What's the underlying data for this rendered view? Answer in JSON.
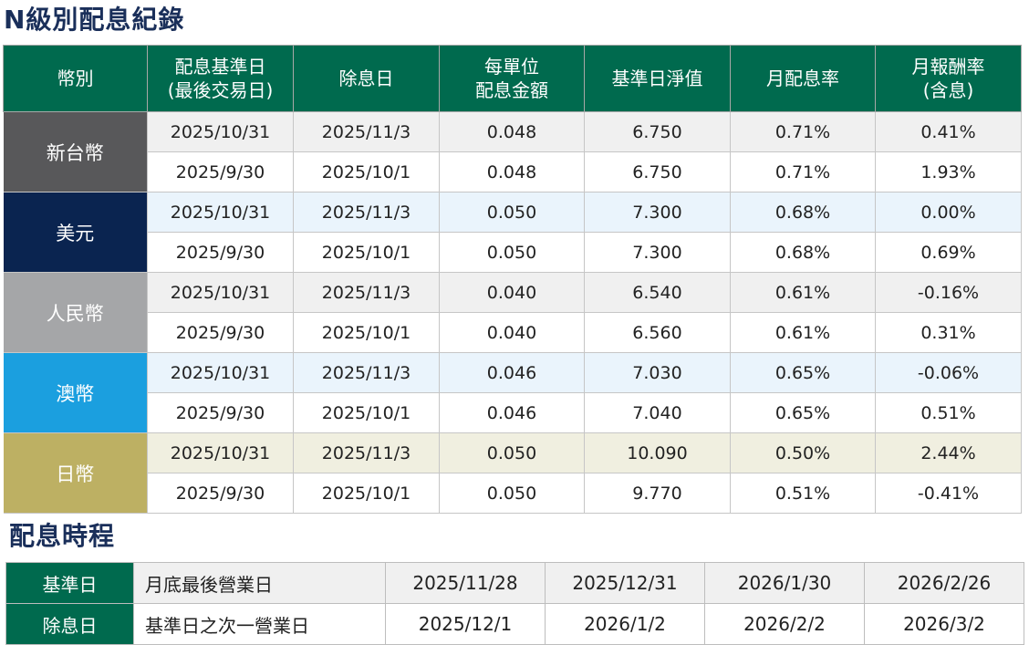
{
  "title": "N級別配息紀錄",
  "headers": [
    {
      "line1": "幣別",
      "line2": ""
    },
    {
      "line1": "配息基準日",
      "line2": "(最後交易日)"
    },
    {
      "line1": "除息日",
      "line2": ""
    },
    {
      "line1": "每單位",
      "line2": "配息金額"
    },
    {
      "line1": "基準日淨值",
      "line2": ""
    },
    {
      "line1": "月配息率",
      "line2": ""
    },
    {
      "line1": "月報酬率",
      "line2": "(含息)"
    }
  ],
  "currencies": [
    {
      "name": "新台幣",
      "color": "#58585a",
      "row_bg": "#f0f0f0",
      "rows": [
        {
          "record_date": "2025/10/31",
          "ex_date": "2025/11/3",
          "amount": "0.048",
          "nav": "6.750",
          "yield": "0.71%",
          "return": "0.41%"
        },
        {
          "record_date": "2025/9/30",
          "ex_date": "2025/10/1",
          "amount": "0.048",
          "nav": "6.750",
          "yield": "0.71%",
          "return": "1.93%"
        }
      ]
    },
    {
      "name": "美元",
      "color": "#0a2450",
      "row_bg": "#eaf4fc",
      "rows": [
        {
          "record_date": "2025/10/31",
          "ex_date": "2025/11/3",
          "amount": "0.050",
          "nav": "7.300",
          "yield": "0.68%",
          "return": "0.00%"
        },
        {
          "record_date": "2025/9/30",
          "ex_date": "2025/10/1",
          "amount": "0.050",
          "nav": "7.300",
          "yield": "0.68%",
          "return": "0.69%"
        }
      ]
    },
    {
      "name": "人民幣",
      "color": "#a5a6a8",
      "row_bg": "#f0f0f0",
      "rows": [
        {
          "record_date": "2025/10/31",
          "ex_date": "2025/11/3",
          "amount": "0.040",
          "nav": "6.540",
          "yield": "0.61%",
          "return": "-0.16%"
        },
        {
          "record_date": "2025/9/30",
          "ex_date": "2025/10/1",
          "amount": "0.040",
          "nav": "6.560",
          "yield": "0.61%",
          "return": "0.31%"
        }
      ]
    },
    {
      "name": "澳幣",
      "color": "#1b9fdf",
      "row_bg": "#eaf4fc",
      "rows": [
        {
          "record_date": "2025/10/31",
          "ex_date": "2025/11/3",
          "amount": "0.046",
          "nav": "7.030",
          "yield": "0.65%",
          "return": "-0.06%"
        },
        {
          "record_date": "2025/9/30",
          "ex_date": "2025/10/1",
          "amount": "0.046",
          "nav": "7.040",
          "yield": "0.65%",
          "return": "0.51%"
        }
      ]
    },
    {
      "name": "日幣",
      "color": "#bdb063",
      "row_bg": "#f0efe0",
      "rows": [
        {
          "record_date": "2025/10/31",
          "ex_date": "2025/11/3",
          "amount": "0.050",
          "nav": "10.090",
          "yield": "0.50%",
          "return": "2.44%"
        },
        {
          "record_date": "2025/9/30",
          "ex_date": "2025/10/1",
          "amount": "0.050",
          "nav": "9.770",
          "yield": "0.51%",
          "return": "-0.41%"
        }
      ]
    }
  ],
  "schedule_title": "配息時程",
  "schedule": [
    {
      "label": "基準日",
      "desc": "月底最後營業日",
      "dates": [
        "2025/11/28",
        "2025/12/31",
        "2026/1/30",
        "2026/2/26"
      ]
    },
    {
      "label": "除息日",
      "desc": "基準日之次一營業日",
      "dates": [
        "2025/12/1",
        "2026/1/2",
        "2026/2/2",
        "2026/3/2"
      ]
    }
  ]
}
